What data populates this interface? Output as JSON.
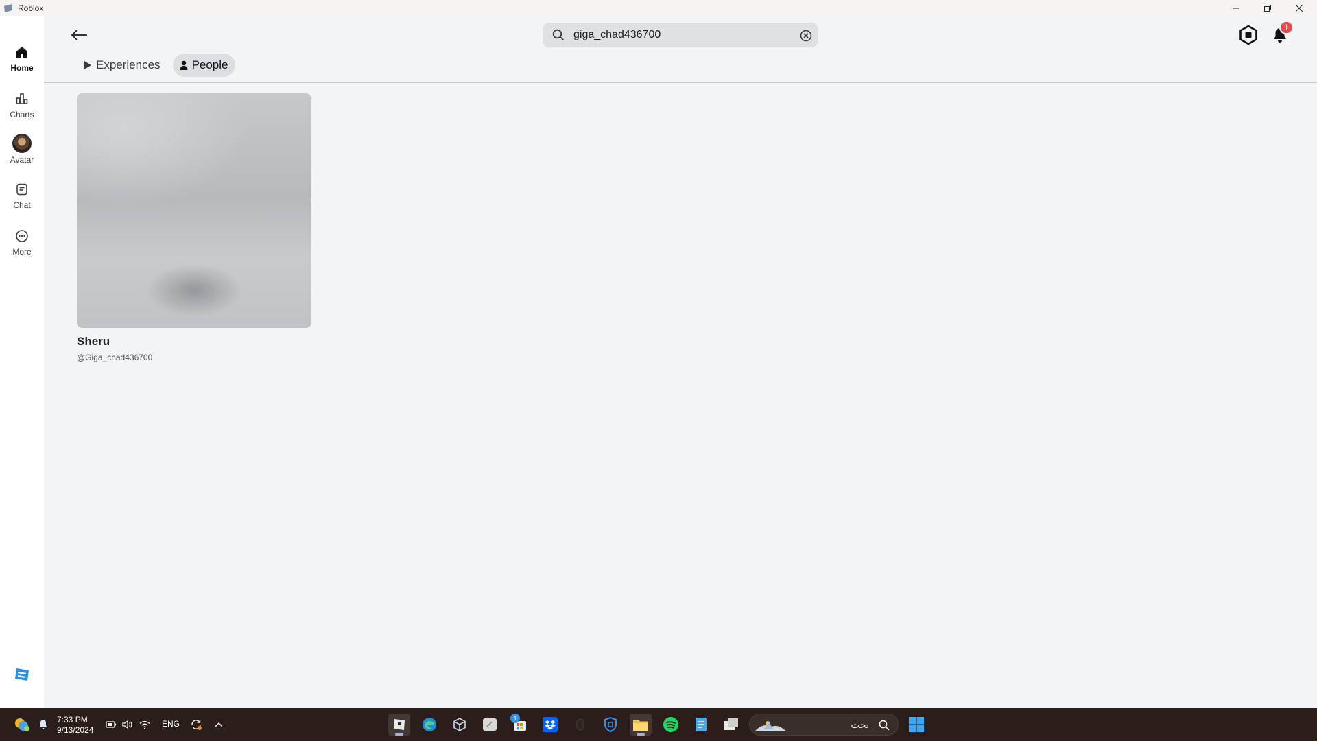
{
  "window": {
    "title": "Roblox"
  },
  "sidebar": {
    "items": [
      {
        "label": "Home",
        "icon": "home-icon",
        "active": true
      },
      {
        "label": "Charts",
        "icon": "charts-icon",
        "active": false
      },
      {
        "label": "Avatar",
        "icon": "avatar-icon",
        "active": false
      },
      {
        "label": "Chat",
        "icon": "chat-icon",
        "active": false
      },
      {
        "label": "More",
        "icon": "more-icon",
        "active": false
      }
    ]
  },
  "header": {
    "search_value": "giga_chad436700",
    "notification_count": "1"
  },
  "tabs": [
    {
      "label": "Experiences",
      "icon": "play-icon",
      "active": false
    },
    {
      "label": "People",
      "icon": "person-icon",
      "active": true
    }
  ],
  "results": [
    {
      "display_name": "Sheru",
      "username": "@Giga_chad436700"
    }
  ],
  "taskbar": {
    "time": "7:33 PM",
    "date": "9/13/2024",
    "language": "ENG",
    "search_text": "بحث",
    "store_badge": "1"
  },
  "colors": {
    "background": "#f2f4f5",
    "sidebar": "#ffffff",
    "badge": "#e5484d",
    "taskbar": "#2a1d1a",
    "roblox_blue": "#2b8fe0"
  }
}
